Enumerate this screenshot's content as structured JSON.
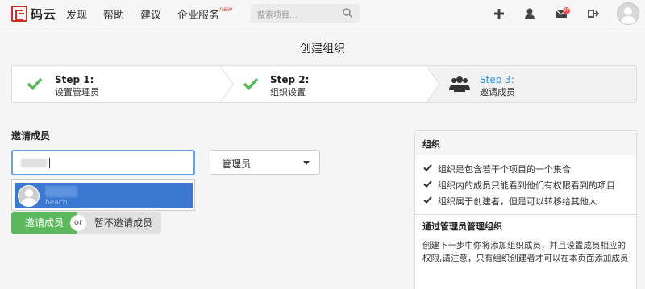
{
  "header": {
    "logo_text": "码云",
    "nav": [
      {
        "label": "发现"
      },
      {
        "label": "帮助"
      },
      {
        "label": "建议"
      },
      {
        "label": "企业服务",
        "badge": "new"
      }
    ],
    "search_placeholder": "搜索项目...",
    "mail_count": "20",
    "icons": [
      "plus-icon",
      "user-icon",
      "mail-icon",
      "logout-icon",
      "avatar"
    ]
  },
  "page": {
    "title": "创建组织"
  },
  "steps": [
    {
      "title": "Step 1:",
      "subtitle": "设置管理员",
      "state": "done"
    },
    {
      "title": "Step 2:",
      "subtitle": "组织设置",
      "state": "done"
    },
    {
      "title": "Step 3:",
      "subtitle": "邀请成员",
      "state": "active"
    }
  ],
  "invite": {
    "label": "邀请成员",
    "role_value": "管理员",
    "suggestion_sub": "beach",
    "invite_button": "邀请成员",
    "or_label": "or",
    "skip_button": "暂不邀请成员"
  },
  "panel": {
    "title": "组织",
    "features": [
      "组织是包含若干个项目的一个集合",
      "组织内的成员只能看到他们有权限看到的项目",
      "组织属于创建者，但是可以转移给其他人"
    ],
    "section_title": "通过管理员管理组织",
    "section_body": "创建下一步中你将添加组织成员，并且设置成员相应的权限,请注意，只有组织创建者才可以在本页面添加成员!"
  },
  "colors": {
    "accent": "#5cb85c",
    "link_blue": "#3a8fd6",
    "selection": "#3a78d1",
    "brand_red": "#c9302c"
  }
}
